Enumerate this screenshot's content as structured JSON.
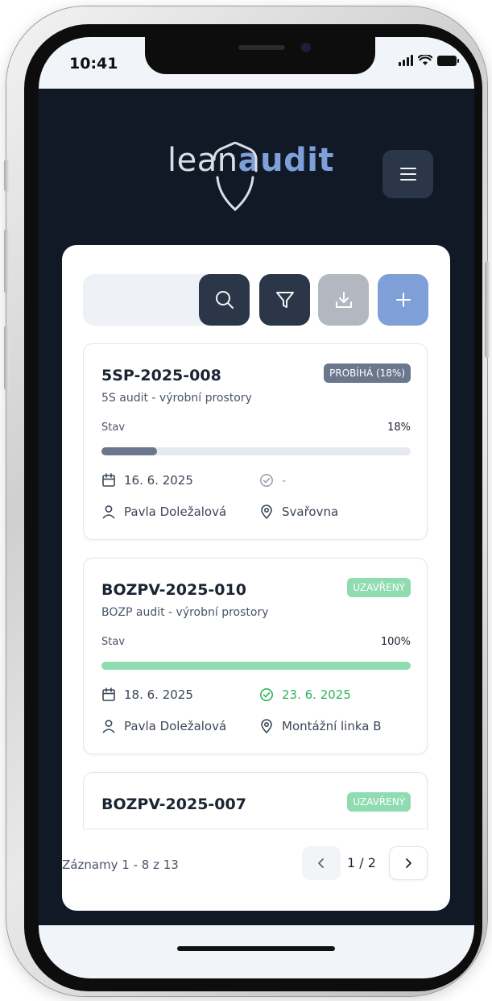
{
  "status_bar": {
    "time": "10:41"
  },
  "header": {
    "logo_part1": "lean",
    "logo_part2": "audit",
    "menu_icon": "hamburger-icon"
  },
  "toolbar": {
    "search_placeholder": "",
    "icons": [
      "search-icon",
      "filter-icon",
      "download-icon",
      "plus-icon"
    ]
  },
  "audits": [
    {
      "code": "5SP-2025-008",
      "badge": "PROBÍHÁ (18%)",
      "badge_color": "#6b778c",
      "subtitle": "5S audit - výrobní prostory",
      "state_label": "Stav",
      "progress_label": "18%",
      "progress": 0.18,
      "progress_color": "#6b778c",
      "date": "16. 6. 2025",
      "closed_date": "-",
      "closed_color": "#9aa3ae",
      "person": "Pavla Doležalová",
      "location": "Svařovna"
    },
    {
      "code": "BOZPV-2025-010",
      "badge": "UZAVŘENÝ",
      "badge_color": "#8fdcb0",
      "subtitle": "BOZP audit - výrobní prostory",
      "state_label": "Stav",
      "progress_label": "100%",
      "progress": 1.0,
      "progress_color": "#8fdcb0",
      "date": "18. 6. 2025",
      "closed_date": "23. 6. 2025",
      "closed_color": "#2fb45a",
      "person": "Pavla Doležalová",
      "location": "Montážní linka B"
    },
    {
      "code": "BOZPV-2025-007",
      "badge": "UZAVŘENÝ",
      "badge_color": "#8fdcb0"
    }
  ],
  "footer": {
    "records": "Záznamy 1 - 8 z 13",
    "page_label": "1 / 2"
  },
  "colors": {
    "background": "#111927",
    "accent": "#7e9fd8",
    "button_dark": "#2b3648"
  }
}
